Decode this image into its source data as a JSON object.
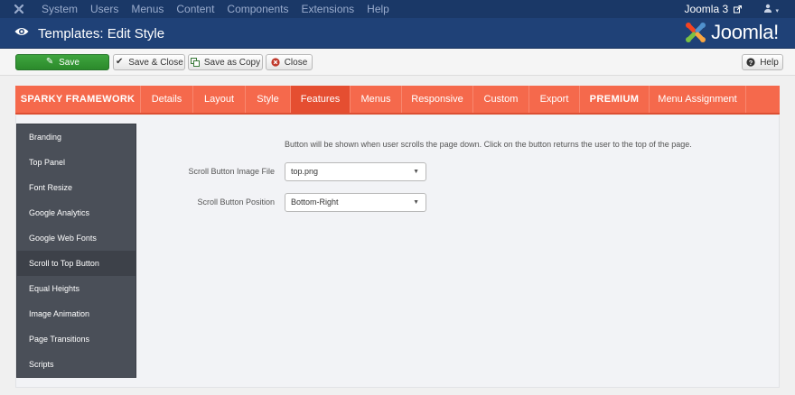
{
  "topnav": {
    "menu": [
      "System",
      "Users",
      "Menus",
      "Content",
      "Components",
      "Extensions",
      "Help"
    ],
    "site_name": "Joomla 3",
    "user_icon": "user-icon"
  },
  "header": {
    "title": "Templates: Edit Style",
    "brand": "Joomla!"
  },
  "toolbar": {
    "save": "Save",
    "save_close": "Save & Close",
    "save_copy": "Save as Copy",
    "close": "Close",
    "help": "Help"
  },
  "tabs": [
    {
      "label": "SPARKY FRAMEWORK",
      "style": "brand"
    },
    {
      "label": "Details"
    },
    {
      "label": "Layout"
    },
    {
      "label": "Style"
    },
    {
      "label": "Features",
      "active": true
    },
    {
      "label": "Menus"
    },
    {
      "label": "Responsive"
    },
    {
      "label": "Custom"
    },
    {
      "label": "Export"
    },
    {
      "label": "PREMIUM",
      "style": "bold"
    },
    {
      "label": "Menu Assignment"
    }
  ],
  "sidebar": {
    "items": [
      {
        "label": "Branding"
      },
      {
        "label": "Top Panel"
      },
      {
        "label": "Font Resize"
      },
      {
        "label": "Google Analytics"
      },
      {
        "label": "Google Web Fonts"
      },
      {
        "label": "Scroll to Top Button",
        "active": true
      },
      {
        "label": "Equal Heights"
      },
      {
        "label": "Image Animation"
      },
      {
        "label": "Page Transitions"
      },
      {
        "label": "Scripts"
      }
    ]
  },
  "form": {
    "description": "Button will be shown when user scrolls the page down. Click on the button returns the user to the top of the page.",
    "image_label": "Scroll Button Image File",
    "image_value": "top.png",
    "position_label": "Scroll Button Position",
    "position_value": "Bottom-Right"
  },
  "colors": {
    "topnav_bg": "#1a3867",
    "header_bg": "#1f4177",
    "tab_bar": "#f5694c",
    "tab_active": "#e54e31",
    "save_green": "#2f962f",
    "sidebar_bg": "#4a4f58"
  }
}
